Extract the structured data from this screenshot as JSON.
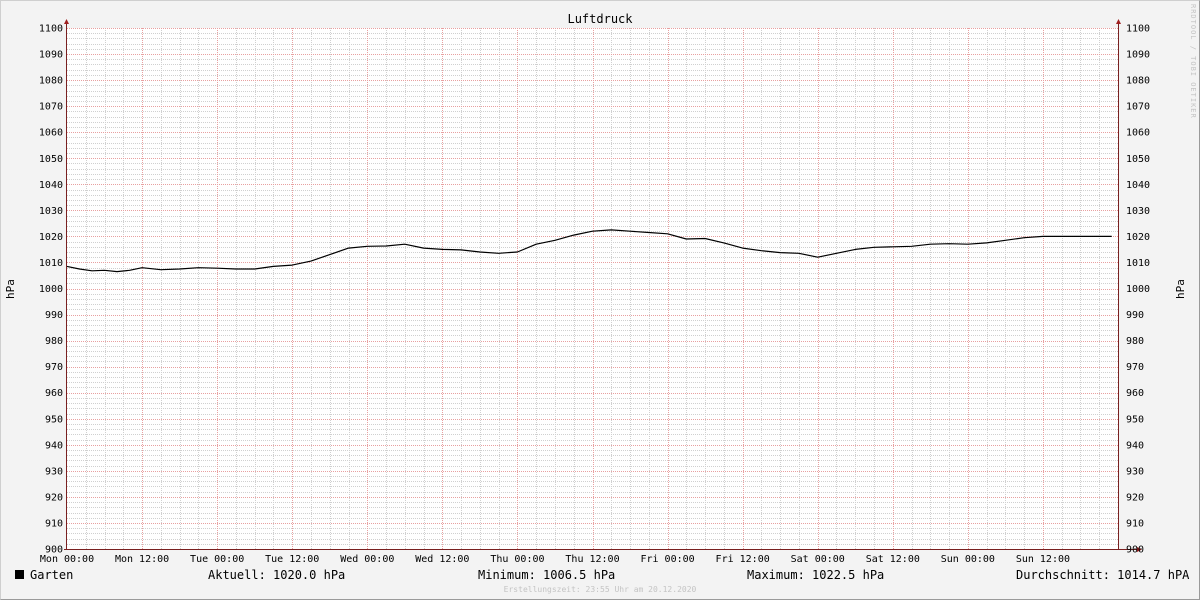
{
  "chart_data": {
    "type": "line",
    "title": "Luftdruck",
    "ylabel": "hPa",
    "ylim": [
      900,
      1100
    ],
    "y_ticks": [
      900,
      910,
      920,
      930,
      940,
      950,
      960,
      970,
      980,
      990,
      1000,
      1010,
      1020,
      1030,
      1040,
      1050,
      1060,
      1070,
      1080,
      1090,
      1100
    ],
    "x_tick_labels": [
      "Mon 00:00",
      "Mon 12:00",
      "Tue 00:00",
      "Tue 12:00",
      "Wed 00:00",
      "Wed 12:00",
      "Thu 00:00",
      "Thu 12:00",
      "Fri 00:00",
      "Fri 12:00",
      "Sat 00:00",
      "Sat 12:00",
      "Sun 00:00",
      "Sun 12:00"
    ],
    "x_unit": "hours since Mon 00:00",
    "grid": true,
    "series": [
      {
        "name": "Garten",
        "color": "#000000",
        "x": [
          0,
          2,
          4,
          6,
          8,
          10,
          12,
          15,
          18,
          21,
          24,
          27,
          30,
          33,
          36,
          39,
          42,
          45,
          48,
          51,
          54,
          57,
          60,
          63,
          66,
          69,
          72,
          75,
          78,
          81,
          84,
          87,
          90,
          93,
          96,
          99,
          102,
          105,
          108,
          111,
          114,
          117,
          120,
          123,
          126,
          129,
          132,
          135,
          138,
          141,
          144,
          147,
          150,
          153,
          156,
          159,
          162,
          165,
          167
        ],
        "values": [
          1008.5,
          1007.5,
          1006.8,
          1007.0,
          1006.5,
          1007.0,
          1008.0,
          1007.2,
          1007.5,
          1008.0,
          1007.8,
          1007.5,
          1007.5,
          1008.5,
          1009.0,
          1010.5,
          1013.0,
          1015.5,
          1016.2,
          1016.3,
          1017.0,
          1015.5,
          1015.0,
          1014.8,
          1014.0,
          1013.5,
          1014.0,
          1017.0,
          1018.5,
          1020.5,
          1022.0,
          1022.5,
          1022.0,
          1021.5,
          1021.0,
          1019.0,
          1019.2,
          1017.5,
          1015.5,
          1014.5,
          1013.8,
          1013.5,
          1012.0,
          1013.5,
          1015.0,
          1015.8,
          1016.0,
          1016.2,
          1017.0,
          1017.2,
          1017.0,
          1017.5,
          1018.5,
          1019.5,
          1020.0,
          1020.0,
          1020.0,
          1020.0,
          1020.0
        ]
      }
    ],
    "legend": {
      "series_name": "Garten",
      "aktuell": "Aktuell: 1020.0 hPa",
      "minimum": "Minimum: 1006.5 hPa",
      "maximum": "Maximum: 1022.5 hPa",
      "durchschnitt": "Durchschnitt: 1014.7 hPA"
    },
    "footer": "Erstellungszeit: 23:55 Uhr am 20.12.2020",
    "watermark": "RRDTOOL / TOBI OETIKER",
    "colors": {
      "background": "#f3f3f3",
      "plot_background": "#ffffff",
      "major_grid": "#e8a0a0",
      "minor_grid": "#d0d0d0",
      "axis": "#7a2020",
      "line": "#000000"
    }
  }
}
